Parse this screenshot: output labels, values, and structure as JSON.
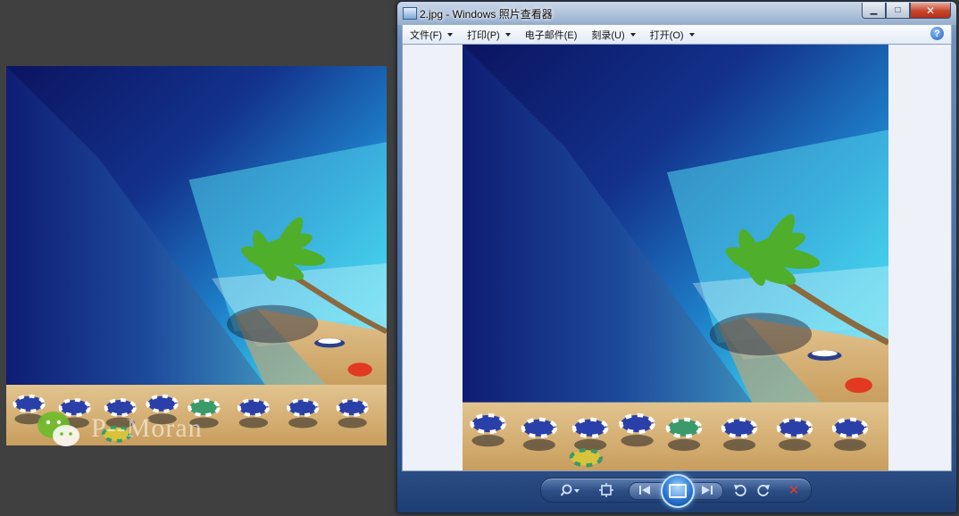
{
  "viewer": {
    "title": "2.jpg - Windows 照片查看器",
    "window_buttons": {
      "minimize": "▁",
      "maximize": "□",
      "close": "✕"
    },
    "menu": [
      {
        "label": "文件(F)",
        "has_dropdown": true
      },
      {
        "label": "打印(P)",
        "has_dropdown": true
      },
      {
        "label": "电子邮件(E)",
        "has_dropdown": false
      },
      {
        "label": "刻录(U)",
        "has_dropdown": true
      },
      {
        "label": "打开(O)",
        "has_dropdown": true
      }
    ],
    "help_icon": "?",
    "controls": {
      "zoom_icon": "magnifier-icon",
      "actual_size_icon": "fit-window-icon",
      "previous_icon": "previous-icon",
      "slideshow_icon": "slideshow-icon",
      "next_icon": "next-icon",
      "rotate_ccw_icon": "rotate-left-icon",
      "rotate_cw_icon": "rotate-right-icon",
      "delete_icon": "✕"
    }
  },
  "left_preview": {
    "watermark_text": "P--Moran"
  },
  "colors": {
    "desktop": "#404040",
    "ocean_deep": "#0d1a6e",
    "ocean_shallow": "#2ec6e6",
    "sand": "#d8b57c",
    "viewer_bg": "#eef1f8",
    "accent_blue": "#2a78d6"
  }
}
